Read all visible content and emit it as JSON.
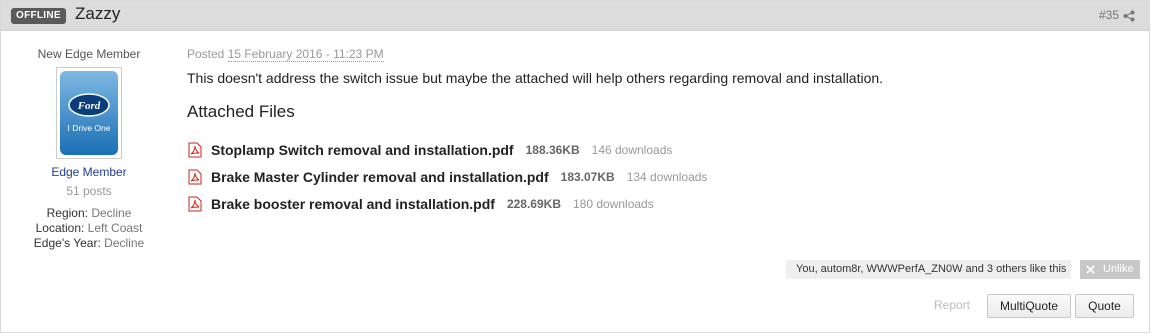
{
  "header": {
    "status": "OFFLINE",
    "author": "Zazzy",
    "post_number": "#35"
  },
  "author_info": {
    "member_title": "New Edge Member",
    "avatar_text": "I Drive One",
    "avatar_brand": "Ford",
    "group": "Edge Member",
    "posts": "51 posts",
    "fields": [
      {
        "label": "Region:",
        "value": "Decline"
      },
      {
        "label": "Location:",
        "value": "Left Coast"
      },
      {
        "label": "Edge's Year:",
        "value": "Decline"
      }
    ]
  },
  "post": {
    "posted_label": "Posted",
    "date": "15 February 2016 - 11:23 PM",
    "text": "This doesn't address the switch issue but maybe the attached will help others regarding removal and installation.",
    "attachments_title": "Attached Files",
    "attachments": [
      {
        "name": "Stoplamp Switch removal and installation.pdf",
        "size": "188.36KB",
        "downloads": "146 downloads"
      },
      {
        "name": "Brake Master Cylinder removal and installation.pdf",
        "size": "183.07KB",
        "downloads": "134 downloads"
      },
      {
        "name": "Brake booster removal and installation.pdf",
        "size": "228.69KB",
        "downloads": "180 downloads"
      }
    ]
  },
  "likes": {
    "text": "You, autom8r, WWWPerfA_ZN0W and 3 others like this",
    "unlike_label": "Unlike"
  },
  "actions": {
    "report": "Report",
    "multiquote": "MultiQuote",
    "quote": "Quote"
  },
  "colors": {
    "header_bg": "#dcdcdc",
    "badge_bg": "#5a5a5a",
    "group_link": "#1c3f94",
    "pdf_red": "#c8261b"
  }
}
